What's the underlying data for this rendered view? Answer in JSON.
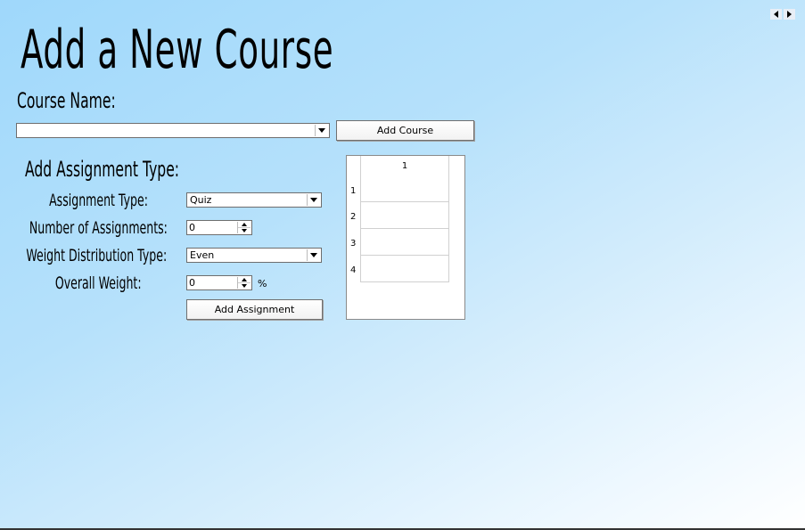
{
  "page": {
    "title": "Add a New Course"
  },
  "course": {
    "name_label": "Course Name:",
    "name_value": "",
    "add_course_label": "Add Course"
  },
  "assignment": {
    "heading": "Add Assignment Type:",
    "type_label": "Assignment Type:",
    "type_value": "Quiz",
    "count_label": "Number of Assignments:",
    "count_value": "0",
    "distribution_label": "Weight Distribution Type:",
    "distribution_value": "Even",
    "weight_label": "Overall Weight:",
    "weight_value": "0",
    "weight_unit": "%",
    "add_assignment_label": "Add Assignment"
  },
  "grid": {
    "column_header": "1",
    "rows": [
      "1",
      "2",
      "3",
      "4"
    ]
  },
  "nav": {
    "icons": [
      "arrow-left-icon",
      "arrow-right-icon"
    ]
  },
  "colors": {
    "background_top": "#9fd8fb",
    "background_bottom": "#ffffff"
  }
}
